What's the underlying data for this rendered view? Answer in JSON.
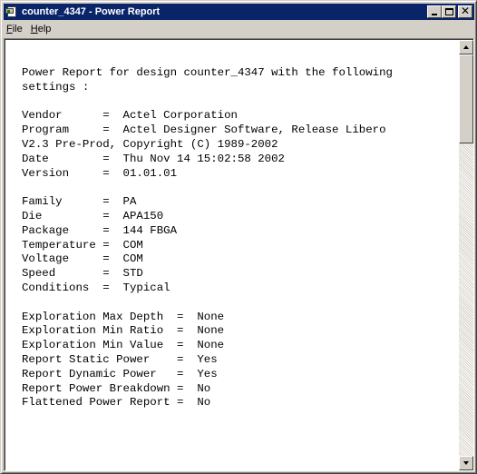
{
  "window": {
    "title": "counter_4347 - Power Report"
  },
  "menu": {
    "items": [
      {
        "accel": "F",
        "rest": "ile"
      },
      {
        "accel": "H",
        "rest": "elp"
      }
    ]
  },
  "report": {
    "lines": [
      "Power Report for design counter_4347 with the following",
      "settings :",
      "",
      "Vendor      =  Actel Corporation",
      "Program     =  Actel Designer Software, Release Libero",
      "V2.3 Pre-Prod, Copyright (C) 1989-2002",
      "Date        =  Thu Nov 14 15:02:58 2002",
      "Version     =  01.01.01",
      "",
      "Family      =  PA",
      "Die         =  APA150",
      "Package     =  144 FBGA",
      "Temperature =  COM",
      "Voltage     =  COM",
      "Speed       =  STD",
      "Conditions  =  Typical",
      "",
      "Exploration Max Depth  =  None",
      "Exploration Min Ratio  =  None",
      "Exploration Min Value  =  None",
      "Report Static Power    =  Yes",
      "Report Dynamic Power   =  Yes",
      "Report Power Breakdown =  No",
      "Flattened Power Report =  No"
    ]
  },
  "icons": {
    "app": "power-report-app-icon",
    "minimize": "minimize-icon",
    "maximize": "maximize-icon",
    "close": "close-icon",
    "scroll_up": "scroll-up-arrow-icon",
    "scroll_down": "scroll-down-arrow-icon"
  },
  "colors": {
    "titlebar": "#0a246a",
    "face": "#d4d0c8",
    "text_area": "#ffffff"
  }
}
